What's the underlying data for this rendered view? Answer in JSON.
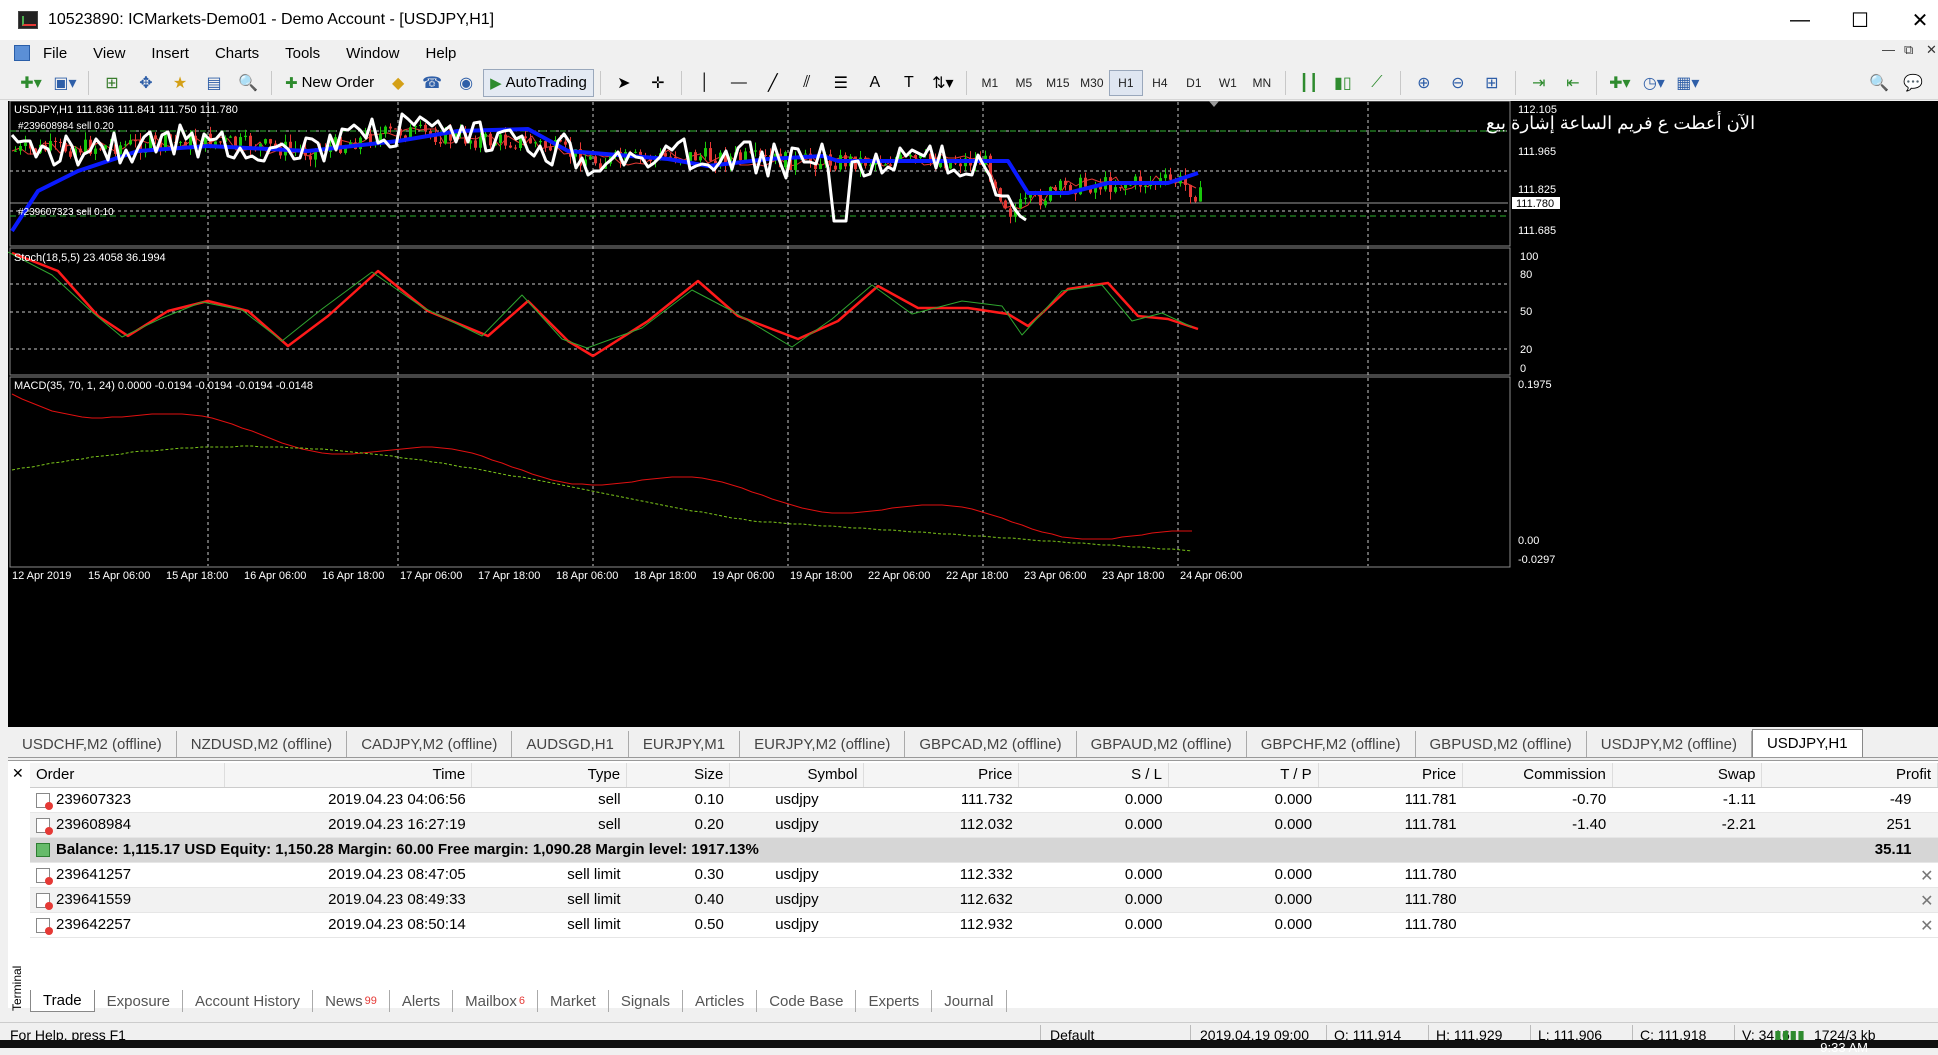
{
  "window": {
    "title": "10523890: ICMarkets-Demo01 - Demo Account - [USDJPY,H1]",
    "minimize": "—",
    "maximize": "☐",
    "close": "✕"
  },
  "menu": [
    "File",
    "View",
    "Insert",
    "Charts",
    "Tools",
    "Window",
    "Help"
  ],
  "toolbar": {
    "new_order": "New Order",
    "autotrading": "AutoTrading",
    "timeframes": [
      "M1",
      "M5",
      "M15",
      "M30",
      "H1",
      "H4",
      "D1",
      "W1",
      "MN"
    ],
    "active_timeframe": "H1"
  },
  "chart": {
    "header": "USDJPY,H1  111.836 111.841 111.750 111.780",
    "annotation": "الآن أعطت ع فريم الساعة إشارة بيع",
    "order_lines": [
      "#239608984 sell 0.20",
      "#239607323 sell 0.10"
    ],
    "current_price": "111.780",
    "price_labels": [
      "112.105",
      "111.965",
      "111.825",
      "111.685"
    ],
    "stoch_header": "Stoch(18,5,5) 23.4058 36.1994",
    "stoch_labels": [
      "100",
      "80",
      "50",
      "20",
      "0"
    ],
    "macd_header": "MACD(35, 70, 1, 24) 0.0000 -0.0194 -0.0194 -0.0194 -0.0148",
    "macd_labels": [
      "0.1975",
      "0.00",
      "-0.0297"
    ],
    "time_labels": [
      "12 Apr 2019",
      "15 Apr 06:00",
      "15 Apr 18:00",
      "16 Apr 06:00",
      "16 Apr 18:00",
      "17 Apr 06:00",
      "17 Apr 18:00",
      "18 Apr 06:00",
      "18 Apr 18:00",
      "19 Apr 06:00",
      "19 Apr 18:00",
      "22 Apr 06:00",
      "22 Apr 18:00",
      "23 Apr 06:00",
      "23 Apr 18:00",
      "24 Apr 06:00"
    ],
    "colors": {
      "bull": "#19c80b",
      "bear": "#e53935",
      "ma_blue": "#0a1aff",
      "ma_white": "#ffffff",
      "ma_red": "#e53935",
      "stoch_main": "#ff1a1a",
      "stoch_signal": "#2fa52f",
      "macd_main": "#e01010",
      "macd_signal": "#7cc61a"
    }
  },
  "chart_tabs": [
    "USDCHF,M2 (offline)",
    "NZDUSD,M2 (offline)",
    "CADJPY,M2 (offline)",
    "AUDSGD,H1",
    "EURJPY,M1",
    "EURJPY,M2 (offline)",
    "GBPCAD,M2 (offline)",
    "GBPAUD,M2 (offline)",
    "GBPCHF,M2 (offline)",
    "GBPUSD,M2 (offline)",
    "USDJPY,M2 (offline)",
    "USDJPY,H1"
  ],
  "terminal": {
    "close": "✕",
    "side_label": "Terminal",
    "columns": [
      "Order",
      "Time",
      "Type",
      "Size",
      "Symbol",
      "Price",
      "S / L",
      "T / P",
      "Price",
      "Commission",
      "Swap",
      "Profit"
    ],
    "rows": [
      [
        "239607323",
        "2019.04.23 04:06:56",
        "sell",
        "0.10",
        "usdjpy",
        "111.732",
        "0.000",
        "0.000",
        "111.781",
        "-0.70",
        "-1.11",
        "-49"
      ],
      [
        "239608984",
        "2019.04.23 16:27:19",
        "sell",
        "0.20",
        "usdjpy",
        "112.032",
        "0.000",
        "0.000",
        "111.781",
        "-1.40",
        "-2.21",
        "251"
      ]
    ],
    "balance_line": "Balance: 1,115.17 USD  Equity: 1,150.28  Margin: 60.00  Free margin: 1,090.28  Margin level: 1917.13%",
    "balance_profit": "35.11",
    "pending": [
      [
        "239641257",
        "2019.04.23 08:47:05",
        "sell limit",
        "0.30",
        "usdjpy",
        "112.332",
        "0.000",
        "0.000",
        "111.780"
      ],
      [
        "239641559",
        "2019.04.23 08:49:33",
        "sell limit",
        "0.40",
        "usdjpy",
        "112.632",
        "0.000",
        "0.000",
        "111.780"
      ],
      [
        "239642257",
        "2019.04.23 08:50:14",
        "sell limit",
        "0.50",
        "usdjpy",
        "112.932",
        "0.000",
        "0.000",
        "111.780"
      ]
    ],
    "close_mark": "✕",
    "tabs": [
      {
        "label": "Trade",
        "badge": ""
      },
      {
        "label": "Exposure",
        "badge": ""
      },
      {
        "label": "Account History",
        "badge": ""
      },
      {
        "label": "News",
        "badge": "99"
      },
      {
        "label": "Alerts",
        "badge": ""
      },
      {
        "label": "Mailbox",
        "badge": "6"
      },
      {
        "label": "Market",
        "badge": ""
      },
      {
        "label": "Signals",
        "badge": ""
      },
      {
        "label": "Articles",
        "badge": ""
      },
      {
        "label": "Code Base",
        "badge": ""
      },
      {
        "label": "Experts",
        "badge": ""
      },
      {
        "label": "Journal",
        "badge": ""
      }
    ]
  },
  "statusbar": {
    "help": "For Help, press F1",
    "profile": "Default",
    "datetime": "2019.04.19 09:00",
    "open": "O: 111.914",
    "high": "H: 111.929",
    "low": "L: 111.906",
    "close": "C: 111.918",
    "volume": "V: 3416",
    "traffic": "1724/3 kb"
  },
  "clock": "9:33 AM"
}
